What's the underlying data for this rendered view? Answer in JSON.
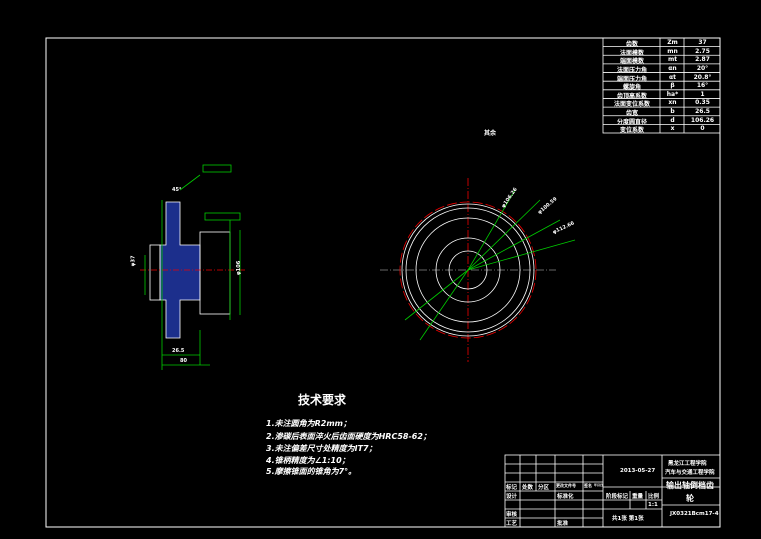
{
  "params": [
    {
      "name": "齿数",
      "sym": "Zm",
      "val": "37"
    },
    {
      "name": "法面模数",
      "sym": "mn",
      "val": "2.75"
    },
    {
      "name": "端面模数",
      "sym": "mt",
      "val": "2.87"
    },
    {
      "name": "法面压力角",
      "sym": "αn",
      "val": "20°"
    },
    {
      "name": "端面压力角",
      "sym": "αt",
      "val": "20.8°"
    },
    {
      "name": "螺旋角",
      "sym": "β",
      "val": "16°"
    },
    {
      "name": "齿顶高系数",
      "sym": "ha*",
      "val": "1"
    },
    {
      "name": "法面变位系数",
      "sym": "xn",
      "val": "0.35"
    },
    {
      "name": "齿宽",
      "sym": "b",
      "val": "26.5"
    },
    {
      "name": "分度圆直径",
      "sym": "d",
      "val": "106.26"
    },
    {
      "name": "变位系数",
      "sym": "x",
      "val": "0"
    }
  ],
  "roughness_note": "其余",
  "requirements": {
    "title": "技术要求",
    "items": [
      "1.未注圆角为R2mm；",
      "2.渗碳后表面淬火后齿面硬度为HRC58-62；",
      "3.未注偏差尺寸处精度为IT7；",
      "4.锥柄精度为∠1:10；",
      "5.摩擦锥面的锥角为7°。"
    ]
  },
  "title_block": {
    "date": "2013-05-27",
    "school": "黑龙江工程学院",
    "college": "汽车与交通工程学院",
    "part_name_1": "输出轴倒档齿",
    "part_name_2": "轮",
    "mark": "标记",
    "count": "处数",
    "zone": "分区",
    "change": "更改文件号",
    "sign": "签名",
    "ymd": "年月日",
    "design": "设计",
    "standard": "标准化",
    "review": "审核",
    "process": "工艺",
    "approve": "批准",
    "stage": "阶段标记",
    "weight": "重量",
    "scale_label": "比例",
    "scale": "1:1",
    "sheets": "共1张 第1张",
    "drawing_no": "JX0321Bcm17-4"
  },
  "dims": {
    "left_top": "45°",
    "left_bore": "φ37",
    "left_od": "φ106",
    "left_width": "26.5",
    "left_total": "80",
    "right_1": "φ106.26",
    "right_2": "φ100.59",
    "right_3": "φ112.66"
  }
}
